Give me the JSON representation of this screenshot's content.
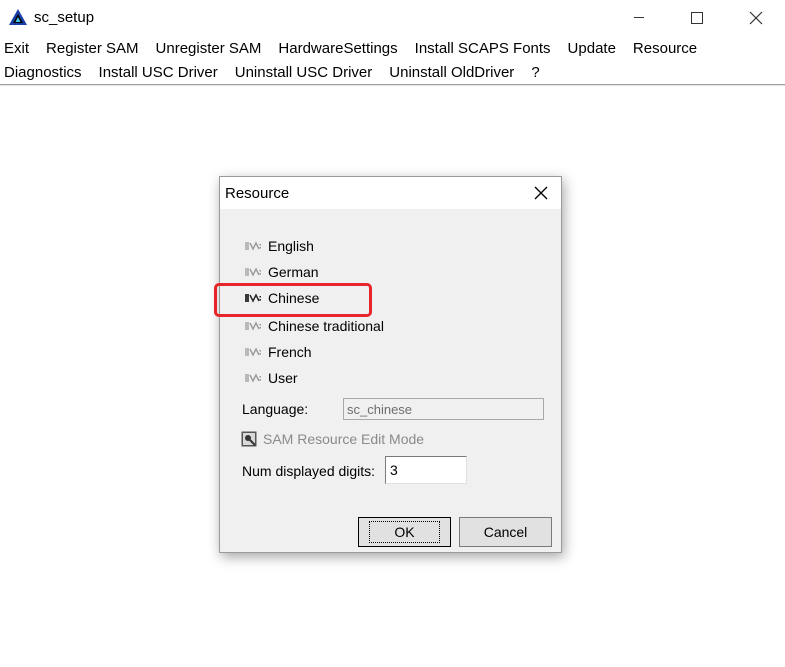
{
  "window": {
    "title": "sc_setup"
  },
  "menu": {
    "row1": [
      "Exit",
      "Register SAM",
      "Unregister SAM",
      "HardwareSettings",
      "Install SCAPS Fonts",
      "Update",
      "Resource"
    ],
    "row2": [
      "Diagnostics",
      "Install USC Driver",
      "Uninstall USC Driver",
      "Uninstall OldDriver",
      "?"
    ]
  },
  "dialog": {
    "title": "Resource",
    "options": [
      {
        "label": "English",
        "selected": false
      },
      {
        "label": "German",
        "selected": false
      },
      {
        "label": "Chinese",
        "selected": true
      },
      {
        "label": "Chinese traditional",
        "selected": false
      },
      {
        "label": "French",
        "selected": false
      },
      {
        "label": "User",
        "selected": false
      }
    ],
    "language_label": "Language:",
    "language_value": "sc_chinese",
    "edit_mode_label": "SAM Resource Edit Mode",
    "digits_label": "Num displayed digits:",
    "digits_value": "3",
    "ok_label": "OK",
    "cancel_label": "Cancel"
  },
  "colors": {
    "highlight": "#e8252a",
    "dialog_bg": "#f0f0f0"
  }
}
